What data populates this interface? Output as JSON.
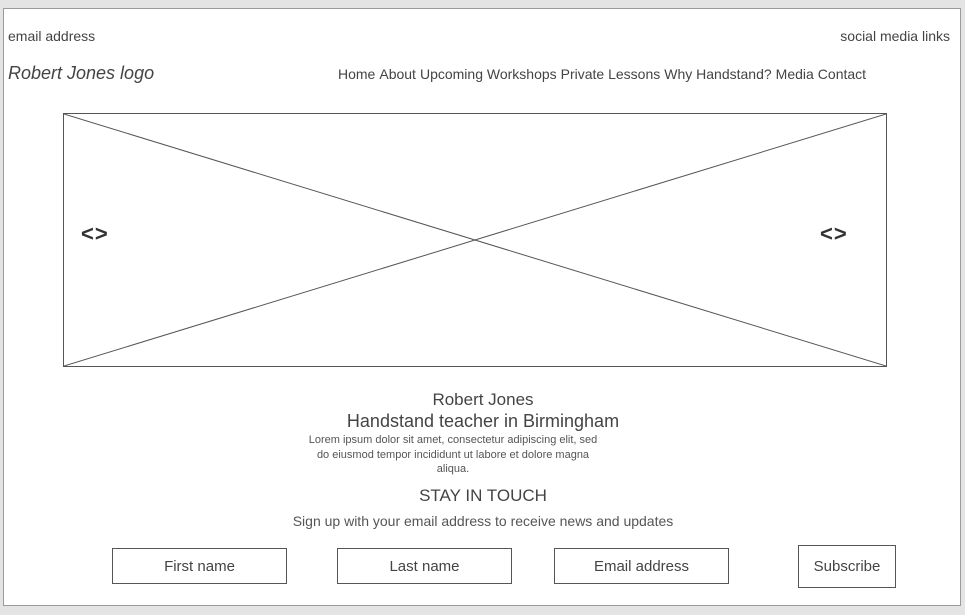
{
  "header": {
    "email": "email address",
    "social": "social media links",
    "logo": "Robert Jones logo",
    "nav": [
      {
        "label": "Home"
      },
      {
        "label": "About"
      },
      {
        "label": "Upcoming Workshops"
      },
      {
        "label": "Private Lessons"
      },
      {
        "label": "Why Handstand?"
      },
      {
        "label": "Media"
      },
      {
        "label": "Contact"
      }
    ]
  },
  "hero": {
    "prev_arrow": "<>",
    "next_arrow": "<>"
  },
  "intro": {
    "name": "Robert Jones",
    "tagline": "Handstand teacher in Birmingham",
    "body": "Lorem ipsum dolor sit amet, consectetur adipiscing elit, sed do eiusmod tempor incididunt ut labore et dolore magna aliqua."
  },
  "newsletter": {
    "heading": "STAY IN TOUCH",
    "subheading": "Sign up with your email address to receive news and updates",
    "first_name": "First name",
    "last_name": "Last name",
    "email": "Email address",
    "submit": "Subscribe"
  }
}
